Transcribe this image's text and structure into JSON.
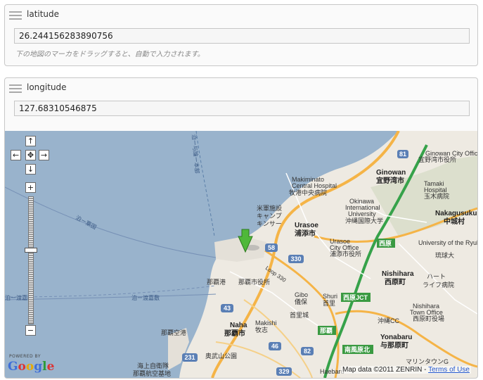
{
  "latitude": {
    "label": "latitude",
    "value": "26.244156283890756",
    "hint": "下の地図のマーカをドラッグすると、自動で入力されます。"
  },
  "longitude": {
    "label": "longitude",
    "value": "127.68310546875"
  },
  "map": {
    "powered_by": "POWERED BY",
    "logo": [
      "G",
      "o",
      "o",
      "g",
      "l",
      "e"
    ],
    "attribution": "Map data ©2011 ZENRIN -",
    "terms_link": "Terms of Use",
    "controls": {
      "pan_up": "↑",
      "pan_left": "←",
      "pan_center": "✥",
      "pan_right": "→",
      "pan_down": "↓",
      "zoom_in": "+",
      "zoom_out": "−"
    },
    "labels": {
      "makiminato": "Makiminato",
      "central_hospital_en": "Central Hospital",
      "makiminato_hospital_jp": "牧港中央病院",
      "ginowan_en": "Ginowan",
      "ginowan_jp": "宜野湾市",
      "ginowan_office_en": "Ginowan City Office",
      "ginowan_office_jp": "宜野湾市役所",
      "tamaki_en": "Tamaki",
      "tamaki_hospital": "Hospital",
      "tamaki_jp": "玉木病院",
      "nakagusuku_en": "Nakagusuku",
      "nakagusuku_jp": "中城村",
      "okinawa_intl_1": "Okinawa",
      "okinawa_intl_2": "International",
      "okinawa_intl_3": "University",
      "okinawa_intl_jp": "沖縄国際大学",
      "urasoe_en": "Urasoe",
      "urasoe_jp": "浦添市",
      "urasoe_office_en": "Urasoe",
      "urasoe_office_en2": "City Office",
      "urasoe_office_jp": "浦添市役所",
      "nishihara_en": "Nishihara",
      "nishihara_jp": "西原町",
      "nishihara_office_en": "Nishihara",
      "nishihara_office_en2": "Town Office",
      "nishihara_office_jp": "西原町役場",
      "ryukyus_1": "University of the Ryukyus",
      "ryukyus_jp": "琉球大",
      "hart_1": "ハート",
      "hart_2": "ライフ病院",
      "beigun_1": "米軍施設",
      "beigun_2": "キャンプ",
      "beigun_3": "キンサー",
      "naha_port": "那覇港",
      "naha_en": "Naha",
      "naha_jp": "那覇市",
      "naha_office": "那覇市役所",
      "makishi_en": "Makishi",
      "makishi_jp": "牧志",
      "gibo_en": "Gibo",
      "gibo_jp": "儀保",
      "shuri_en": "Shuri",
      "shuri_jp": "首里",
      "shurijo": "首里城",
      "naha_airport": "那覇空港",
      "okunoyama": "奥武山公園",
      "sdf_1": "海上自衛隊",
      "sdf_2": "那覇航空基地",
      "loop": "Loop 330",
      "nishihara_jct": "西原JCT",
      "nishihara_label": "西原",
      "naha_ic": "那覇",
      "minami_haebaru_kita": "南風原北",
      "yonabaru_en": "Yonabaru",
      "yonabaru_jp": "与那原町",
      "yonabaru_cc": "沖縄CC",
      "marine_town": "マリンタウンG",
      "haebaru": "Haebaru",
      "tomari_1": "泊ー与論ー本部",
      "tomari_2": "泊ー渡嘉敷",
      "tomari_3": "泊ー粟国",
      "tomari_4": "泊ー渡嘉敷",
      "r58": "58",
      "r330": "330",
      "r43": "43",
      "r46": "46",
      "r231": "231",
      "r82": "82",
      "r329": "329",
      "r81": "81"
    }
  }
}
